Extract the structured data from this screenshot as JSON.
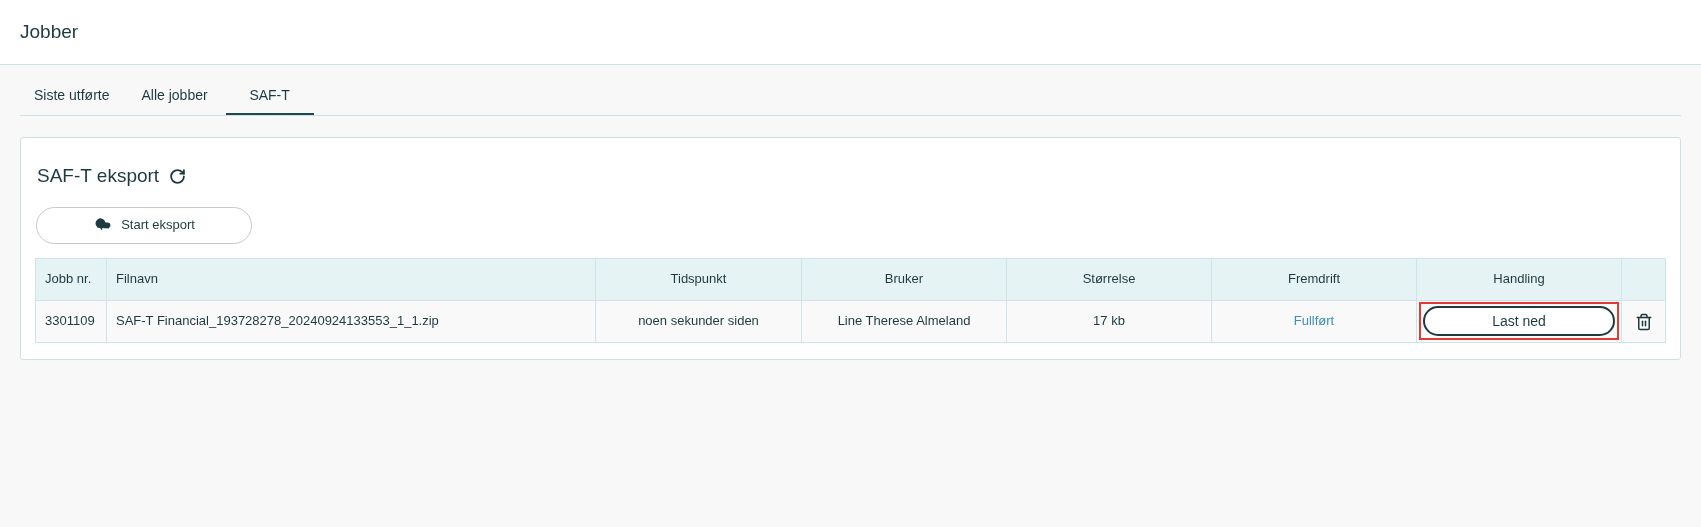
{
  "page_title": "Jobber",
  "tabs": [
    {
      "label": "Siste utførte",
      "selected": false
    },
    {
      "label": "Alle jobber",
      "selected": false
    },
    {
      "label": "SAF-T",
      "selected": true
    }
  ],
  "card": {
    "title": "SAF-T eksport",
    "start_button": "Start eksport"
  },
  "table": {
    "columns": [
      "Jobb nr.",
      "Filnavn",
      "Tidspunkt",
      "Bruker",
      "Størrelse",
      "Fremdrift",
      "Handling"
    ],
    "rows": [
      {
        "job": "3301109",
        "filename": "SAF-T Financial_193728278_20240924133553_1_1.zip",
        "time": "noen sekunder siden",
        "user": "Line Therese Almeland",
        "size": "17 kb",
        "progress": "Fullført",
        "action": "Last ned",
        "highlighted": true
      }
    ]
  }
}
